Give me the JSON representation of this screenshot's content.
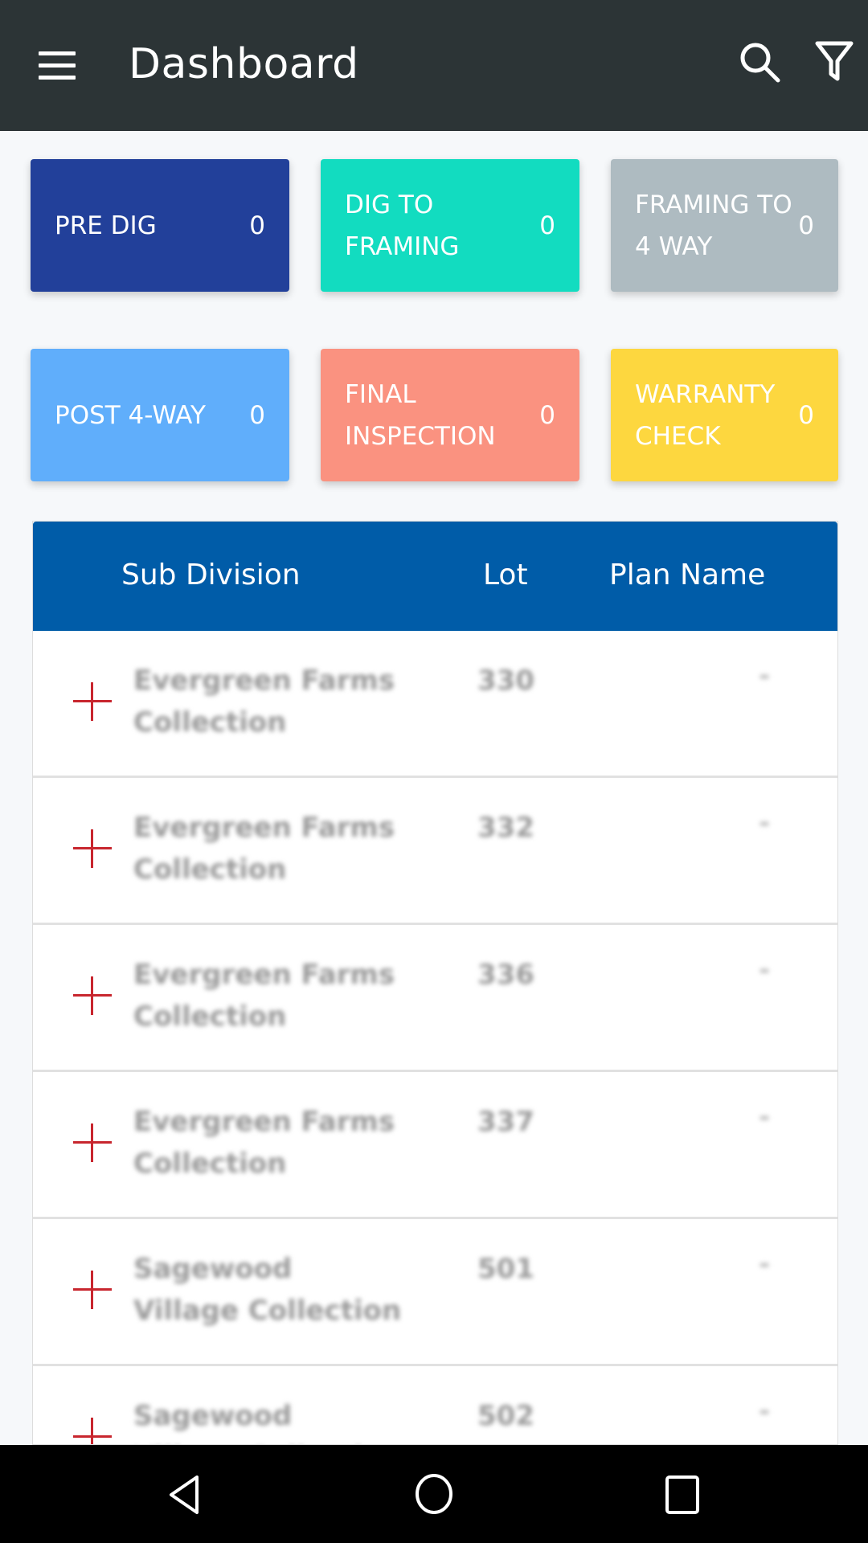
{
  "header": {
    "title": "Dashboard",
    "icons": [
      "menu-icon",
      "search-icon",
      "filter-icon"
    ]
  },
  "cards": [
    {
      "label": "PRE DIG",
      "count": "0",
      "color": "#22409a"
    },
    {
      "label": "DIG TO FRAMING",
      "count": "0",
      "color": "#12dcc0"
    },
    {
      "label": "FRAMING TO 4 WAY",
      "count": "0",
      "color": "#aebbc1"
    },
    {
      "label": "POST 4-WAY",
      "count": "0",
      "color": "#60aefb"
    },
    {
      "label": "FINAL INSPECTION",
      "count": "0",
      "color": "#fa9280"
    },
    {
      "label": "WARRANTY CHECK",
      "count": "0",
      "color": "#fdd73f"
    }
  ],
  "table": {
    "columns": [
      "Sub Division",
      "Lot",
      "Plan Name"
    ],
    "rows": [
      {
        "subdivision": "Evergreen Farms Collection",
        "lot": "330",
        "plan": "-"
      },
      {
        "subdivision": "Evergreen Farms Collection",
        "lot": "332",
        "plan": "-"
      },
      {
        "subdivision": "Evergreen Farms Collection",
        "lot": "336",
        "plan": "-"
      },
      {
        "subdivision": "Evergreen Farms Collection",
        "lot": "337",
        "plan": "-"
      },
      {
        "subdivision": "Sagewood Village Collection",
        "lot": "501",
        "plan": "-"
      },
      {
        "subdivision": "Sagewood Village Collection",
        "lot": "502",
        "plan": "-"
      }
    ]
  },
  "navbar": {
    "icons": [
      "back-icon",
      "home-icon",
      "recents-icon"
    ]
  }
}
